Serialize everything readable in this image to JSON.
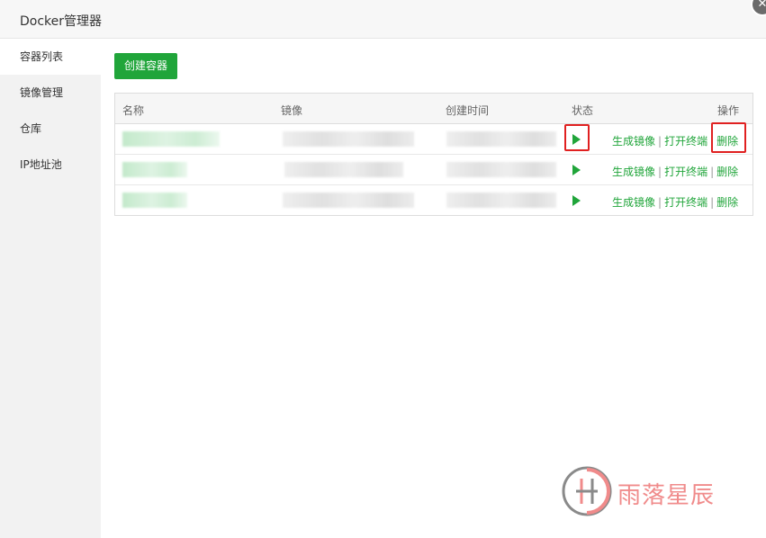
{
  "window": {
    "title": "Docker管理器",
    "close_icon": "close-icon"
  },
  "sidebar": {
    "items": [
      {
        "label": "容器列表",
        "active": true
      },
      {
        "label": "镜像管理",
        "active": false
      },
      {
        "label": "仓库",
        "active": false
      },
      {
        "label": "IP地址池",
        "active": false
      }
    ]
  },
  "toolbar": {
    "create_label": "创建容器"
  },
  "table": {
    "columns": [
      "名称",
      "镜像",
      "创建时间",
      "状态",
      "操作"
    ],
    "rows": [
      {
        "status_icon": "play-icon",
        "actions": [
          "生成镜像",
          "打开终端",
          "删除"
        ]
      },
      {
        "status_icon": "play-icon",
        "actions": [
          "生成镜像",
          "打开终端",
          "删除"
        ]
      },
      {
        "status_icon": "play-icon",
        "actions": [
          "生成镜像",
          "打开终端",
          "删除"
        ]
      }
    ]
  },
  "watermark": {
    "text": "雨落星辰"
  },
  "colors": {
    "accent": "#20a53a",
    "highlight": "#e02020",
    "sidebar_bg": "#f2f2f2"
  }
}
